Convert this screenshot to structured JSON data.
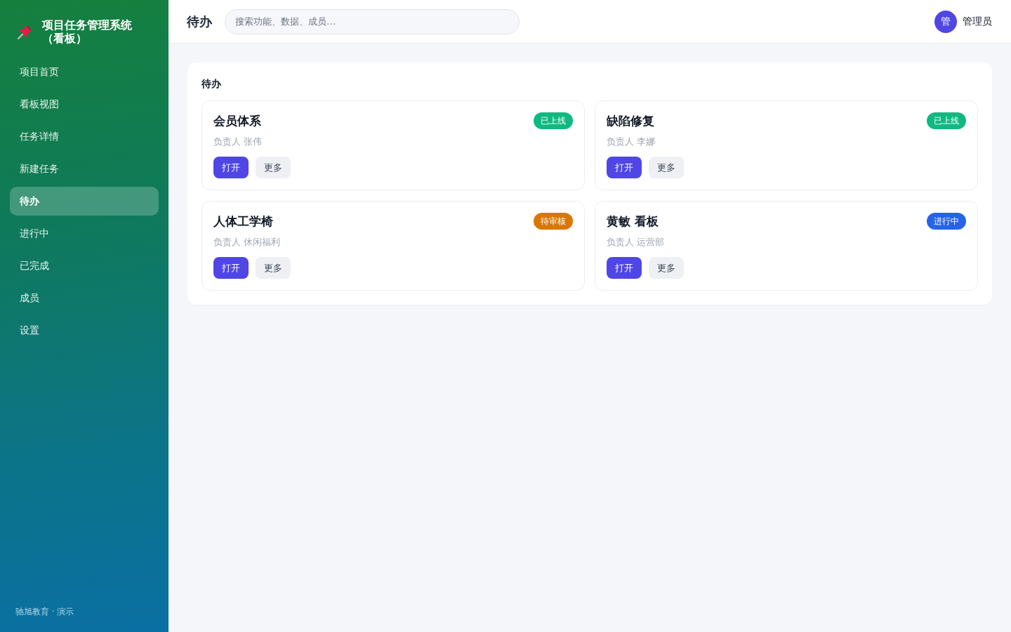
{
  "sidebar": {
    "logo": {
      "title": "项目任务管理系统（看板）"
    },
    "nav": [
      {
        "label": "项目首页",
        "selected": false
      },
      {
        "label": "看板视图",
        "selected": false
      },
      {
        "label": "任务详情",
        "selected": false
      },
      {
        "label": "新建任务",
        "selected": false
      },
      {
        "label": "待办",
        "selected": true
      },
      {
        "label": "进行中",
        "selected": false
      },
      {
        "label": "已完成",
        "selected": false
      },
      {
        "label": "成员",
        "selected": false
      },
      {
        "label": "设置",
        "selected": false
      }
    ],
    "footer": "驰旭教育 · 演示"
  },
  "topbar": {
    "title": "待办",
    "search": {
      "placeholder": "搜索功能、数据、成员…"
    },
    "user": {
      "avatar": "管",
      "name": "管理员"
    }
  },
  "panel": {
    "title": "待办",
    "cards": [
      {
        "title": "会员体系",
        "owner": "负责人 张伟",
        "status": {
          "label": "已上线",
          "color": "#10b981"
        },
        "actions": [
          {
            "label": "打开",
            "kind": "primary"
          },
          {
            "label": "更多",
            "kind": "secondary"
          }
        ]
      },
      {
        "title": "缺陷修复",
        "owner": "负责人 李娜",
        "status": {
          "label": "已上线",
          "color": "#10b981"
        },
        "actions": [
          {
            "label": "打开",
            "kind": "primary"
          },
          {
            "label": "更多",
            "kind": "secondary"
          }
        ]
      },
      {
        "title": "人体工学椅",
        "owner": "负责人 休闲福利",
        "status": {
          "label": "待审核",
          "color": "#d97706"
        },
        "actions": [
          {
            "label": "打开",
            "kind": "primary"
          },
          {
            "label": "更多",
            "kind": "secondary"
          }
        ]
      },
      {
        "title": "黄敏 看板",
        "owner": "负责人 运营部",
        "status": {
          "label": "进行中",
          "color": "#2563eb"
        },
        "actions": [
          {
            "label": "打开",
            "kind": "primary"
          },
          {
            "label": "更多",
            "kind": "secondary"
          }
        ]
      }
    ]
  }
}
